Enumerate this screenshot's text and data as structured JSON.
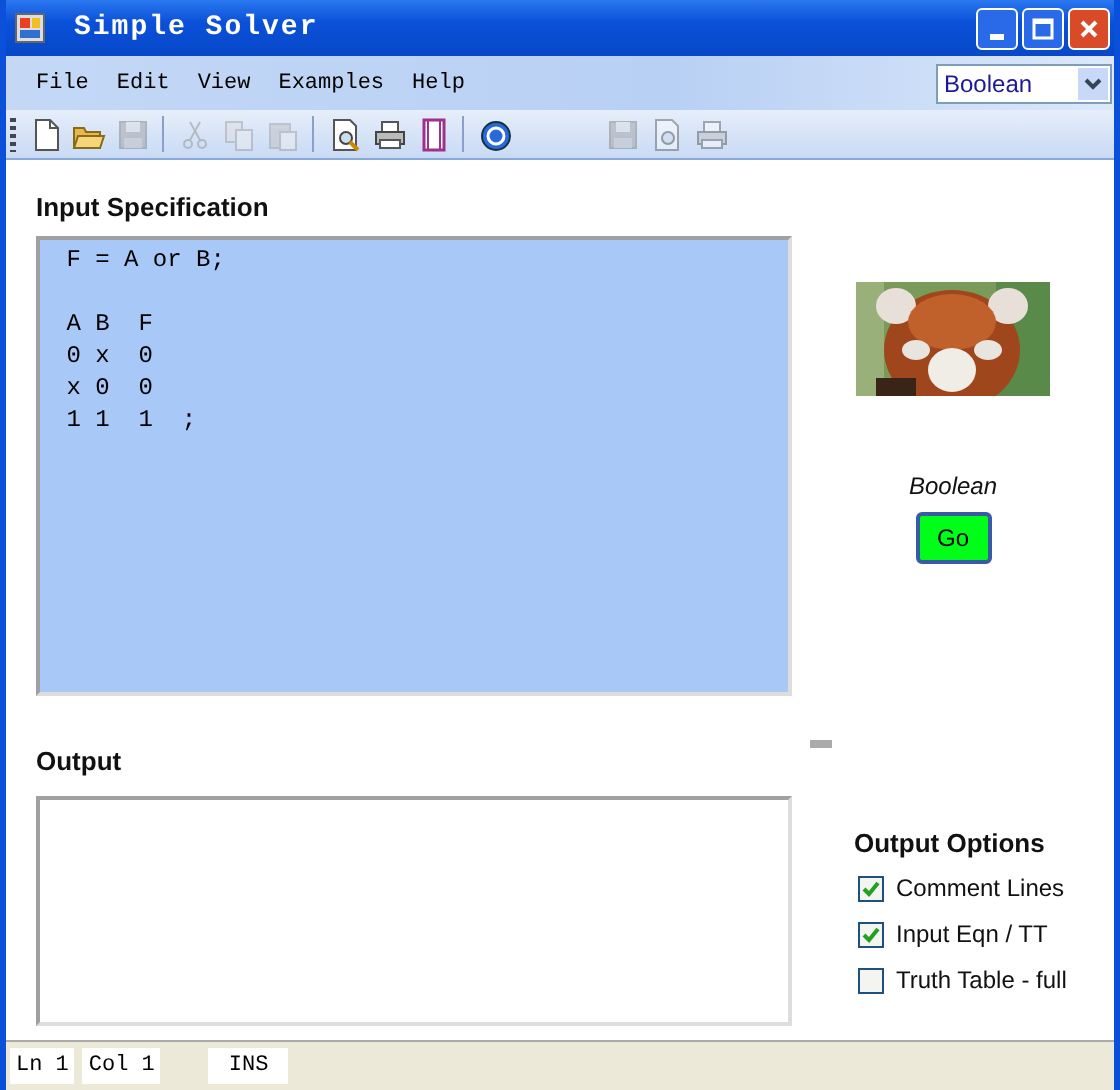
{
  "window": {
    "title": "Simple Solver"
  },
  "menu": [
    "File",
    "Edit",
    "View",
    "Examples",
    "Help"
  ],
  "mode_select": {
    "value": "Boolean"
  },
  "toolbar": [
    {
      "disabled": false
    },
    {
      "disabled": false
    },
    {
      "disabled": true
    },
    {
      "disabled": true
    },
    {
      "disabled": true
    },
    {
      "disabled": true
    },
    {
      "disabled": false
    },
    {
      "disabled": false
    },
    {
      "disabled": false
    },
    {
      "disabled": false
    },
    {
      "disabled": true
    },
    {
      "disabled": true
    },
    {
      "disabled": true
    }
  ],
  "input": {
    "label": "Input Specification",
    "value": " F = A or B;\n\n A B  F\n 0 x  0\n x 0  0\n 1 1  1  ;"
  },
  "output": {
    "label": "Output"
  },
  "side": {
    "mode_label": "Boolean",
    "go_button": "Go"
  },
  "output_options": {
    "title": "Output Options",
    "items": [
      {
        "label": "Comment Lines",
        "checked": true
      },
      {
        "label": "Input Eqn / TT",
        "checked": true
      },
      {
        "label": "Truth Table - full",
        "checked": false
      }
    ]
  },
  "status_bar": [
    "Ln 1",
    "Col 1",
    "INS"
  ]
}
